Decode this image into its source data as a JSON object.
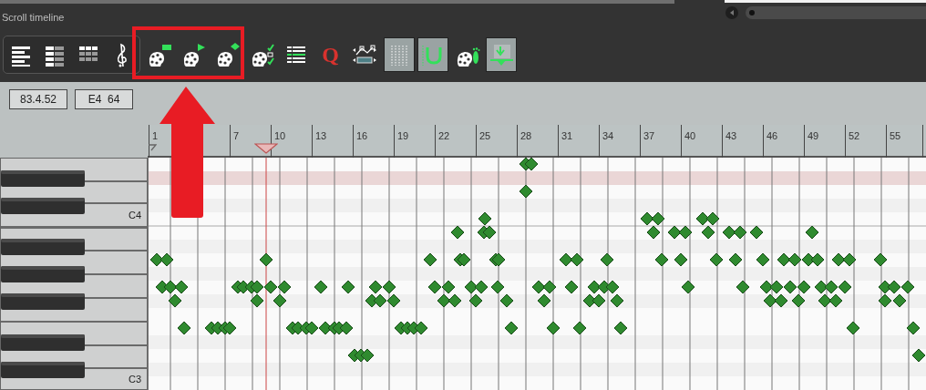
{
  "title": "Scroll timeline",
  "view_buttons": [
    {
      "kind": "piano",
      "pressed": false
    },
    {
      "kind": "named-notes",
      "pressed": false
    },
    {
      "kind": "grid-notes",
      "pressed": false
    },
    {
      "kind": "clef",
      "pressed": false
    }
  ],
  "tool_buttons": [
    {
      "kind": "palette-rect",
      "pressed": false
    },
    {
      "kind": "palette-triangle",
      "pressed": false
    },
    {
      "kind": "palette-diamond",
      "pressed": false
    },
    {
      "kind": "palette-checks",
      "pressed": false
    },
    {
      "kind": "list",
      "pressed": false
    },
    {
      "kind": "quantize",
      "label": "Q",
      "pressed": false
    },
    {
      "kind": "envelope",
      "pressed": false
    },
    {
      "kind": "grid",
      "pressed": true
    },
    {
      "kind": "magnet",
      "pressed": true
    },
    {
      "kind": "palette-foot",
      "pressed": false
    },
    {
      "kind": "insert",
      "pressed": true
    }
  ],
  "position_field": "83.4.52",
  "note_field": "E4  64",
  "ruler": [
    "1",
    "7",
    "10",
    "13",
    "16",
    "19",
    "22",
    "25",
    "28",
    "31",
    "34",
    "37",
    "40",
    "43",
    "46",
    "49",
    "52",
    "55"
  ],
  "key_labels": [
    {
      "label": "C4"
    },
    {
      "label": "C3"
    }
  ]
}
